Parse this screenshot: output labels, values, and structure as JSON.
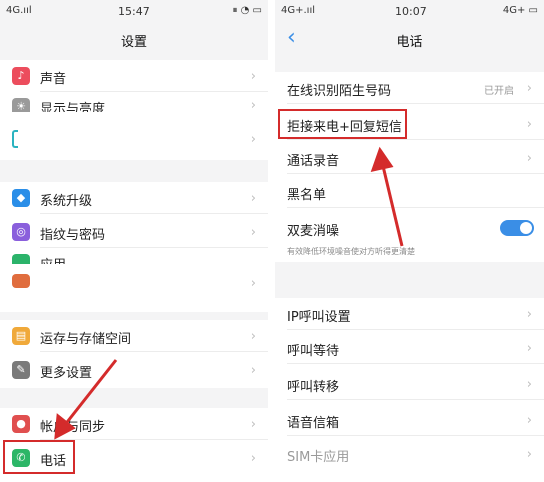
{
  "left": {
    "status": {
      "network": "4G.ııl",
      "time": "15:47",
      "icons": "⏸ ◔ ▭"
    },
    "title": "设置",
    "items": [
      {
        "label": "声音",
        "icon": "speaker-icon",
        "color": "#ec4d5d"
      },
      {
        "label": "显示与亮度",
        "icon": "brightness-icon",
        "color": "#9a9a9a"
      },
      {
        "label": "",
        "icon": "teal-bracket-icon",
        "color": "#2bb3c0"
      },
      {
        "label": "系统升级",
        "icon": "update-icon",
        "color": "#2a8ee8"
      },
      {
        "label": "指纹与密码",
        "icon": "fingerprint-icon",
        "color": "#8a5fdc"
      },
      {
        "label": "应用",
        "icon": "apps-icon",
        "color": "#2bb36a"
      },
      {
        "label": "",
        "icon": "blank-icon",
        "color": "#e06d3e"
      },
      {
        "label": "运存与存储空间",
        "icon": "storage-icon",
        "color": "#f0a93a"
      },
      {
        "label": "更多设置",
        "icon": "wrench-icon",
        "color": "#7a7a7a"
      },
      {
        "label": "帐户与同步",
        "icon": "account-icon",
        "color": "#e04f4f"
      },
      {
        "label": "电话",
        "icon": "phone-icon",
        "color": "#2cb667"
      }
    ]
  },
  "right": {
    "status": {
      "network": "4G+.ııl",
      "time": "10:07",
      "icons": "4G+ ▭"
    },
    "back": "‹",
    "title": "电话",
    "items": [
      {
        "label": "在线识别陌生号码",
        "value": "已开启"
      },
      {
        "label": "拒接来电+回复短信"
      },
      {
        "label": "通话录音"
      },
      {
        "label": "黑名单"
      },
      {
        "label": "双麦消噪"
      },
      {
        "label": "IP呼叫设置"
      },
      {
        "label": "呼叫等待"
      },
      {
        "label": "呼叫转移"
      },
      {
        "label": "语音信箱"
      },
      {
        "label": "SIM卡应用"
      }
    ],
    "noise_hint": "有效降低环境噪音使对方听得更清楚",
    "noise_toggle_on": true
  },
  "chevron": "›",
  "highlight_color": "#d42b2b"
}
